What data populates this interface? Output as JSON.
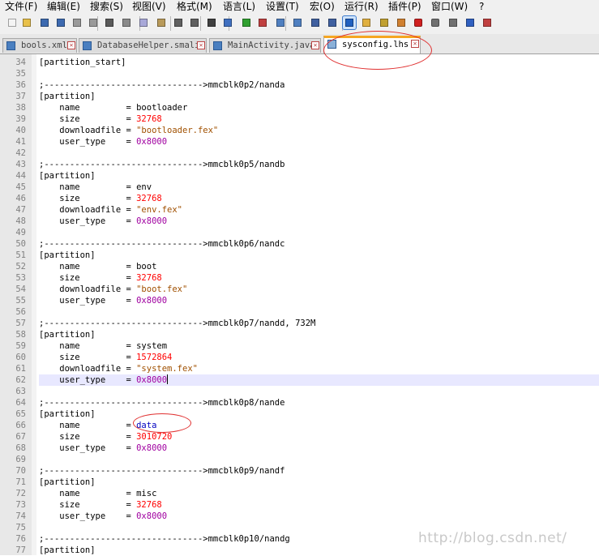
{
  "menu": [
    "文件(F)",
    "编辑(E)",
    "搜索(S)",
    "视图(V)",
    "格式(M)",
    "语言(L)",
    "设置(T)",
    "宏(O)",
    "运行(R)",
    "插件(P)",
    "窗口(W)",
    "?"
  ],
  "toolbar_icons": [
    "new-file-icon",
    "open-file-icon",
    "save-icon",
    "save-all-icon",
    "close-icon",
    "close-all-icon",
    "print-icon",
    "cut-icon",
    "copy-icon",
    "paste-icon",
    "undo-icon",
    "redo-icon",
    "find-icon",
    "replace-icon",
    "zoom-in-icon",
    "zoom-out-icon",
    "sync-vertical-icon",
    "sync-horizontal-icon",
    "word-wrap-icon",
    "show-all-chars-icon",
    "indent-guide-icon",
    "doc-map-icon",
    "function-list-icon",
    "folder-workspace-icon",
    "record-macro-icon",
    "stop-record-icon",
    "play-macro-icon",
    "run-macro-multiple-icon",
    "save-macro-icon"
  ],
  "tabs": [
    {
      "label": "bools.xml"
    },
    {
      "label": "DatabaseHelper.smali"
    },
    {
      "label": "MainActivity.java"
    },
    {
      "label": "sysconfig.lhs"
    }
  ],
  "lines": [
    {
      "n": "34",
      "t": [
        {
          "k": "plain",
          "v": "[partition_start]"
        }
      ]
    },
    {
      "n": "35",
      "t": []
    },
    {
      "n": "36",
      "t": [
        {
          "k": "comment",
          "v": ";------------------------------->mmcblk0p2/nanda"
        }
      ]
    },
    {
      "n": "37",
      "t": [
        {
          "k": "plain",
          "v": "[partition]"
        }
      ]
    },
    {
      "n": "38",
      "t": [
        {
          "k": "plain",
          "v": "    name         = bootloader"
        }
      ]
    },
    {
      "n": "39",
      "t": [
        {
          "k": "plain",
          "v": "    size         = "
        },
        {
          "k": "num",
          "v": "32768"
        }
      ]
    },
    {
      "n": "40",
      "t": [
        {
          "k": "plain",
          "v": "    downloadfile = "
        },
        {
          "k": "str",
          "v": "\"bootloader.fex\""
        }
      ]
    },
    {
      "n": "41",
      "t": [
        {
          "k": "plain",
          "v": "    user_type    = "
        },
        {
          "k": "hex",
          "v": "0x8000"
        }
      ]
    },
    {
      "n": "42",
      "t": []
    },
    {
      "n": "43",
      "t": [
        {
          "k": "comment",
          "v": ";------------------------------->mmcblk0p5/nandb"
        }
      ]
    },
    {
      "n": "44",
      "t": [
        {
          "k": "plain",
          "v": "[partition]"
        }
      ]
    },
    {
      "n": "45",
      "t": [
        {
          "k": "plain",
          "v": "    name         = env"
        }
      ]
    },
    {
      "n": "46",
      "t": [
        {
          "k": "plain",
          "v": "    size         = "
        },
        {
          "k": "num",
          "v": "32768"
        }
      ]
    },
    {
      "n": "47",
      "t": [
        {
          "k": "plain",
          "v": "    downloadfile = "
        },
        {
          "k": "str",
          "v": "\"env.fex\""
        }
      ]
    },
    {
      "n": "48",
      "t": [
        {
          "k": "plain",
          "v": "    user_type    = "
        },
        {
          "k": "hex",
          "v": "0x8000"
        }
      ]
    },
    {
      "n": "49",
      "t": []
    },
    {
      "n": "50",
      "t": [
        {
          "k": "comment",
          "v": ";------------------------------->mmcblk0p6/nandc"
        }
      ]
    },
    {
      "n": "51",
      "t": [
        {
          "k": "plain",
          "v": "[partition]"
        }
      ]
    },
    {
      "n": "52",
      "t": [
        {
          "k": "plain",
          "v": "    name         = boot"
        }
      ]
    },
    {
      "n": "53",
      "t": [
        {
          "k": "plain",
          "v": "    size         = "
        },
        {
          "k": "num",
          "v": "32768"
        }
      ]
    },
    {
      "n": "54",
      "t": [
        {
          "k": "plain",
          "v": "    downloadfile = "
        },
        {
          "k": "str",
          "v": "\"boot.fex\""
        }
      ]
    },
    {
      "n": "55",
      "t": [
        {
          "k": "plain",
          "v": "    user_type    = "
        },
        {
          "k": "hex",
          "v": "0x8000"
        }
      ]
    },
    {
      "n": "56",
      "t": []
    },
    {
      "n": "57",
      "t": [
        {
          "k": "comment",
          "v": ";------------------------------->mmcblk0p7/nandd, 732M"
        }
      ]
    },
    {
      "n": "58",
      "t": [
        {
          "k": "plain",
          "v": "[partition]"
        }
      ]
    },
    {
      "n": "59",
      "t": [
        {
          "k": "plain",
          "v": "    name         = system"
        }
      ]
    },
    {
      "n": "60",
      "t": [
        {
          "k": "plain",
          "v": "    size         = "
        },
        {
          "k": "num",
          "v": "1572864"
        }
      ]
    },
    {
      "n": "61",
      "t": [
        {
          "k": "plain",
          "v": "    downloadfile = "
        },
        {
          "k": "str",
          "v": "\"system.fex\""
        }
      ]
    },
    {
      "n": "62",
      "t": [
        {
          "k": "plain",
          "v": "    user_type    = "
        },
        {
          "k": "hex",
          "v": "0x8000"
        },
        {
          "k": "caret",
          "v": ""
        }
      ],
      "current": true
    },
    {
      "n": "63",
      "t": []
    },
    {
      "n": "64",
      "t": [
        {
          "k": "comment",
          "v": ";------------------------------->mmcblk0p8/nande"
        }
      ]
    },
    {
      "n": "65",
      "t": [
        {
          "k": "plain",
          "v": "[partition]"
        }
      ]
    },
    {
      "n": "66",
      "t": [
        {
          "k": "plain",
          "v": "    name         = "
        },
        {
          "k": "ident",
          "v": "data"
        }
      ]
    },
    {
      "n": "67",
      "t": [
        {
          "k": "plain",
          "v": "    size         = "
        },
        {
          "k": "num",
          "v": "3010720"
        }
      ]
    },
    {
      "n": "68",
      "t": [
        {
          "k": "plain",
          "v": "    user_type    = "
        },
        {
          "k": "hex",
          "v": "0x8000"
        }
      ]
    },
    {
      "n": "69",
      "t": []
    },
    {
      "n": "70",
      "t": [
        {
          "k": "comment",
          "v": ";------------------------------->mmcblk0p9/nandf"
        }
      ]
    },
    {
      "n": "71",
      "t": [
        {
          "k": "plain",
          "v": "[partition]"
        }
      ]
    },
    {
      "n": "72",
      "t": [
        {
          "k": "plain",
          "v": "    name         = misc"
        }
      ]
    },
    {
      "n": "73",
      "t": [
        {
          "k": "plain",
          "v": "    size         = "
        },
        {
          "k": "num",
          "v": "32768"
        }
      ]
    },
    {
      "n": "74",
      "t": [
        {
          "k": "plain",
          "v": "    user_type    = "
        },
        {
          "k": "hex",
          "v": "0x8000"
        }
      ]
    },
    {
      "n": "75",
      "t": []
    },
    {
      "n": "76",
      "t": [
        {
          "k": "comment",
          "v": ";------------------------------->mmcblk0p10/nandg"
        }
      ]
    },
    {
      "n": "77",
      "t": [
        {
          "k": "plain",
          "v": "[partition]"
        }
      ]
    }
  ],
  "watermark": "http://blog.csdn.net/"
}
